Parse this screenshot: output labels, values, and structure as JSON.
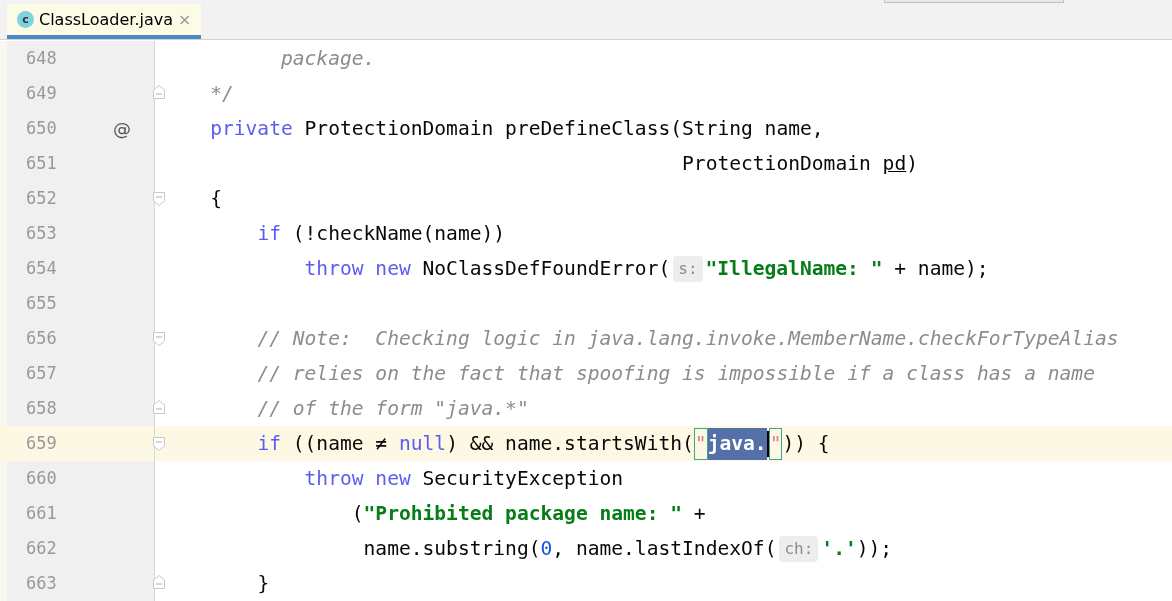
{
  "tab": {
    "icon_letter": "c",
    "title": "ClassLoader.java",
    "close": "×",
    "selected": true
  },
  "lines": [
    {
      "number": "648",
      "fold_start": false,
      "fold_end": false,
      "current": false,
      "tokens": [
        {
          "kind": "comment",
          "text": "          package."
        }
      ]
    },
    {
      "number": "649",
      "fold_start": false,
      "fold_end": true,
      "current": false,
      "tokens": [
        {
          "kind": "comment",
          "text": "    */"
        }
      ]
    },
    {
      "number": "650",
      "fold_start": false,
      "fold_end": false,
      "gutter_mark": "@",
      "current": false,
      "tokens": [
        {
          "kind": "keyword",
          "text": "    private"
        },
        {
          "kind": "code",
          "text": " ProtectionDomain preDefineClass(String name,"
        }
      ]
    },
    {
      "number": "651",
      "fold_start": false,
      "fold_end": false,
      "current": false,
      "tokens": [
        {
          "kind": "code",
          "text": "                                            ProtectionDomain "
        },
        {
          "kind": "underlined",
          "text": "pd"
        },
        {
          "kind": "code",
          "text": ")"
        }
      ]
    },
    {
      "number": "652",
      "fold_start": true,
      "fold_end": false,
      "current": false,
      "tokens": [
        {
          "kind": "code",
          "text": "    {"
        }
      ]
    },
    {
      "number": "653",
      "fold_start": false,
      "fold_end": false,
      "current": false,
      "tokens": [
        {
          "kind": "keyword",
          "text": "        if"
        },
        {
          "kind": "code",
          "text": " (!checkName(name))"
        }
      ]
    },
    {
      "number": "654",
      "fold_start": false,
      "fold_end": false,
      "current": false,
      "tokens": [
        {
          "kind": "keyword",
          "text": "            throw new"
        },
        {
          "kind": "code",
          "text": " NoClassDefFoundError("
        },
        {
          "kind": "hint",
          "text": "s:"
        },
        {
          "kind": "string",
          "text": "\"IllegalName: \""
        },
        {
          "kind": "code",
          "text": " + name);"
        }
      ]
    },
    {
      "number": "655",
      "fold_start": false,
      "fold_end": false,
      "current": false
    },
    {
      "number": "656",
      "fold_start": true,
      "fold_end": false,
      "current": false,
      "tokens": [
        {
          "kind": "comment",
          "text": "        // Note:  Checking logic in java.lang.invoke.MemberName.checkForTypeAlias"
        }
      ]
    },
    {
      "number": "657",
      "fold_start": false,
      "fold_end": false,
      "current": false,
      "tokens": [
        {
          "kind": "comment",
          "text": "        // relies on the fact that spoofing is impossible if a class has a name"
        }
      ]
    },
    {
      "number": "658",
      "fold_start": false,
      "fold_end": true,
      "current": false,
      "tokens": [
        {
          "kind": "comment",
          "text": "        // of the form \"java.*\""
        }
      ]
    },
    {
      "number": "659",
      "fold_start": true,
      "fold_end": false,
      "current": true,
      "tokens": [
        {
          "kind": "keyword",
          "text": "        if"
        },
        {
          "kind": "code",
          "text": " ((name ≠ "
        },
        {
          "kind": "keyword",
          "text": "null"
        },
        {
          "kind": "code",
          "text": ") && name.startsWith("
        },
        {
          "kind": "quote",
          "text": "\""
        },
        {
          "kind": "selected",
          "text": "java."
        },
        {
          "kind": "caret"
        },
        {
          "kind": "quote",
          "text": "\""
        },
        {
          "kind": "code",
          "text": ")) {"
        }
      ]
    },
    {
      "number": "660",
      "fold_start": false,
      "fold_end": false,
      "current": false,
      "tokens": [
        {
          "kind": "keyword",
          "text": "            throw new"
        },
        {
          "kind": "code",
          "text": " SecurityException"
        }
      ]
    },
    {
      "number": "661",
      "fold_start": false,
      "fold_end": false,
      "current": false,
      "tokens": [
        {
          "kind": "code",
          "text": "                ("
        },
        {
          "kind": "string",
          "text": "\"Prohibited package name: \""
        },
        {
          "kind": "code",
          "text": " +"
        }
      ]
    },
    {
      "number": "662",
      "fold_start": false,
      "fold_end": false,
      "current": false,
      "tokens": [
        {
          "kind": "code",
          "text": "                 name.substring("
        },
        {
          "kind": "number",
          "text": "0"
        },
        {
          "kind": "code",
          "text": ", name.lastIndexOf("
        },
        {
          "kind": "hint",
          "text": "ch:"
        },
        {
          "kind": "string",
          "text": "'.'"
        },
        {
          "kind": "code",
          "text": "));"
        }
      ]
    },
    {
      "number": "663",
      "fold_start": false,
      "fold_end": true,
      "current": false,
      "tokens": [
        {
          "kind": "code",
          "text": "        }"
        }
      ]
    }
  ]
}
